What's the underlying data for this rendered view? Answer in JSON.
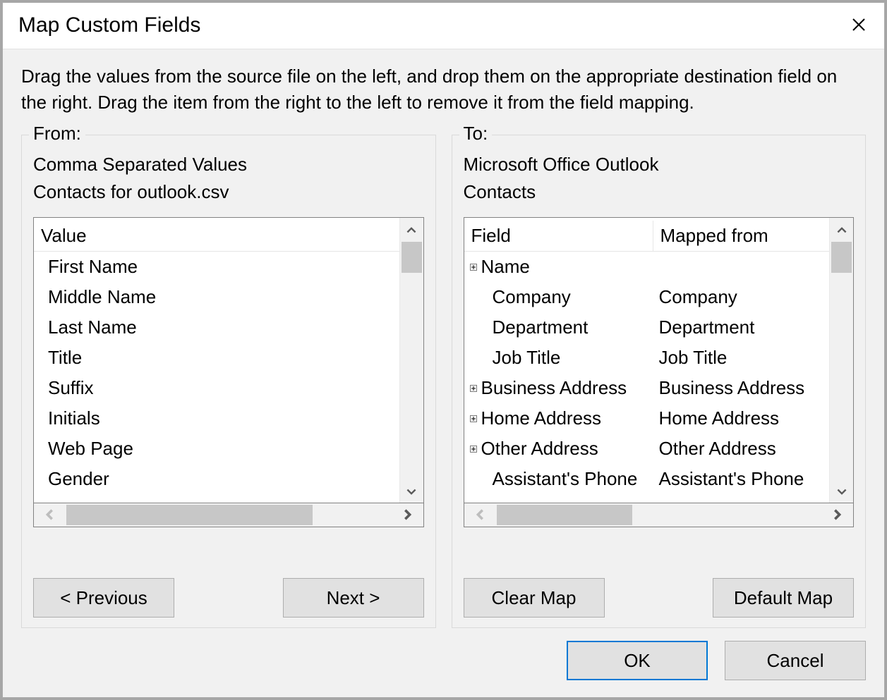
{
  "title": "Map Custom Fields",
  "instructions": "Drag the values from the source file on the left, and drop them on the appropriate destination field on the right.  Drag the item from the right to the left to remove it from the field mapping.",
  "from": {
    "label": "From:",
    "format": "Comma Separated Values",
    "file": "Contacts for outlook.csv",
    "header": "Value",
    "items": [
      "First Name",
      "Middle Name",
      "Last Name",
      "Title",
      "Suffix",
      "Initials",
      "Web Page",
      "Gender"
    ]
  },
  "to": {
    "label": "To:",
    "app": "Microsoft Office Outlook",
    "folder": "Contacts",
    "header_field": "Field",
    "header_mapped": "Mapped from",
    "items": [
      {
        "expand": true,
        "indent": false,
        "field": "Name",
        "mapped": ""
      },
      {
        "expand": false,
        "indent": true,
        "field": "Company",
        "mapped": "Company"
      },
      {
        "expand": false,
        "indent": true,
        "field": "Department",
        "mapped": "Department"
      },
      {
        "expand": false,
        "indent": true,
        "field": "Job Title",
        "mapped": "Job Title"
      },
      {
        "expand": true,
        "indent": false,
        "field": "Business Address",
        "mapped": "Business Address"
      },
      {
        "expand": true,
        "indent": false,
        "field": "Home Address",
        "mapped": "Home Address"
      },
      {
        "expand": true,
        "indent": false,
        "field": "Other Address",
        "mapped": "Other Address"
      },
      {
        "expand": false,
        "indent": true,
        "field": "Assistant's Phone",
        "mapped": "Assistant's Phone"
      }
    ]
  },
  "buttons": {
    "previous": "< Previous",
    "next": "Next >",
    "clear_map": "Clear Map",
    "default_map": "Default Map",
    "ok": "OK",
    "cancel": "Cancel"
  }
}
